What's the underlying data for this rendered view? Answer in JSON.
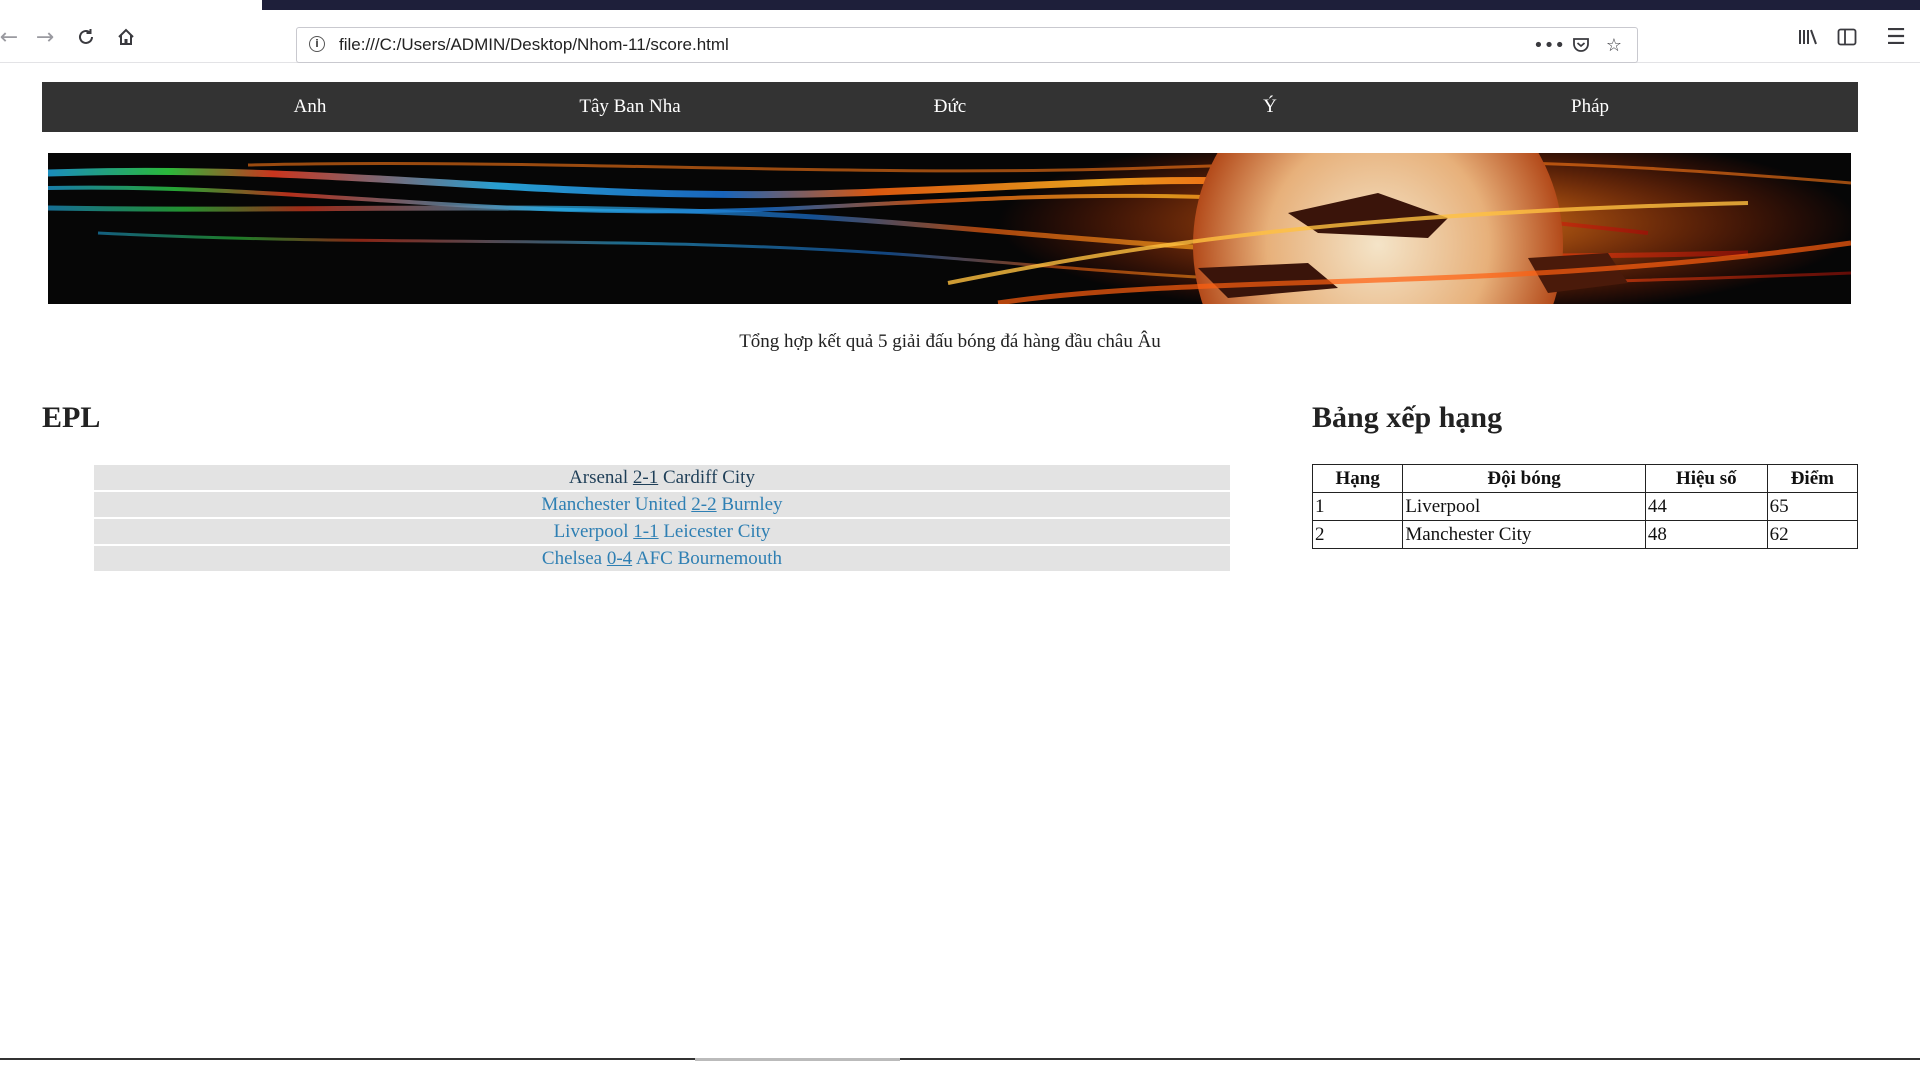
{
  "browser": {
    "url": "file:///C:/Users/ADMIN/Desktop/Nhom-11/score.html"
  },
  "nav": {
    "items": [
      "Anh",
      "Tây Ban Nha",
      "Đức",
      "Ý",
      "Pháp"
    ]
  },
  "subtitle": "Tổng hợp kết quả 5 giải đấu bóng đá hàng đầu châu Âu",
  "epl": {
    "heading": "EPL",
    "matches": [
      {
        "home": "Arsenal",
        "score": "2-1",
        "away": "Cardiff City"
      },
      {
        "home": "Manchester United",
        "score": "2-2",
        "away": "Burnley"
      },
      {
        "home": "Liverpool",
        "score": "1-1",
        "away": "Leicester City"
      },
      {
        "home": "Chelsea",
        "score": "0-4",
        "away": "AFC Bournemouth"
      }
    ]
  },
  "standings": {
    "heading": "Bảng xếp hạng",
    "columns": [
      "Hạng",
      "Đội bóng",
      "Hiệu số",
      "Điểm"
    ],
    "rows": [
      [
        "1",
        "Liverpool",
        "44",
        "65"
      ],
      [
        "2",
        "Manchester City",
        "48",
        "62"
      ]
    ]
  },
  "icons": {
    "back": "back-arrow-icon",
    "forward": "forward-arrow-icon",
    "reload": "reload-icon",
    "home": "home-icon",
    "info": "info-icon",
    "more": "more-dots-icon",
    "pocket": "pocket-icon",
    "bookmark": "star-icon",
    "library": "library-icon",
    "sidebar": "sidebar-icon",
    "menu": "hamburger-menu-icon"
  },
  "colors": {
    "nav_bg": "#333333",
    "match_row_bg": "#e3e3e3",
    "link": "#2e7fb3"
  }
}
